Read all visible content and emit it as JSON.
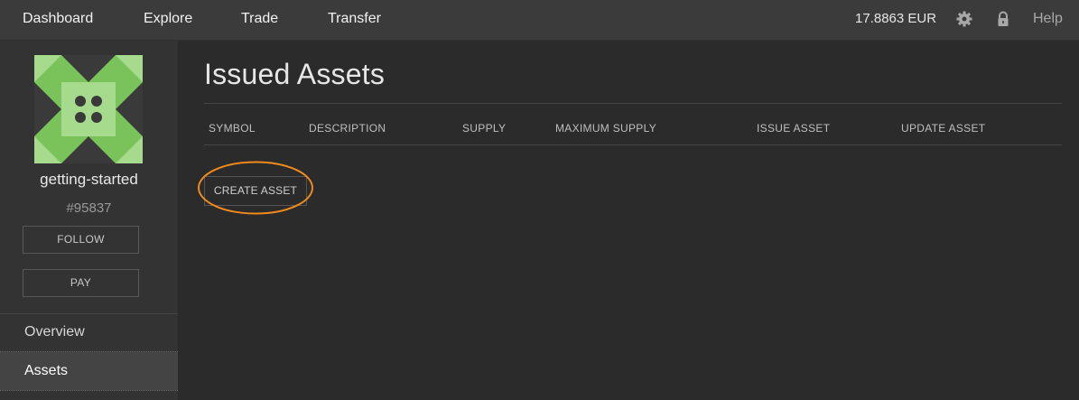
{
  "nav": {
    "dashboard": "Dashboard",
    "explore": "Explore",
    "trade": "Trade",
    "transfer": "Transfer",
    "balance": "17.8863 EUR",
    "settings_icon": "gear-icon",
    "lock_icon": "lock-icon",
    "help": "Help"
  },
  "account": {
    "name": "getting-started",
    "id": "#95837",
    "follow_label": "FOLLOW",
    "pay_label": "PAY",
    "identicon_colors": [
      "#7ac35a",
      "#a6da8c",
      "#3a3a3a"
    ]
  },
  "sidebar": {
    "items": [
      {
        "label": "Overview",
        "active": false
      },
      {
        "label": "Assets",
        "active": true
      }
    ]
  },
  "main": {
    "title": "Issued Assets",
    "columns": [
      "SYMBOL",
      "DESCRIPTION",
      "SUPPLY",
      "MAXIMUM SUPPLY",
      "ISSUE ASSET",
      "UPDATE ASSET"
    ],
    "create_label": "CREATE ASSET",
    "highlight_color": "#f08a1c"
  }
}
